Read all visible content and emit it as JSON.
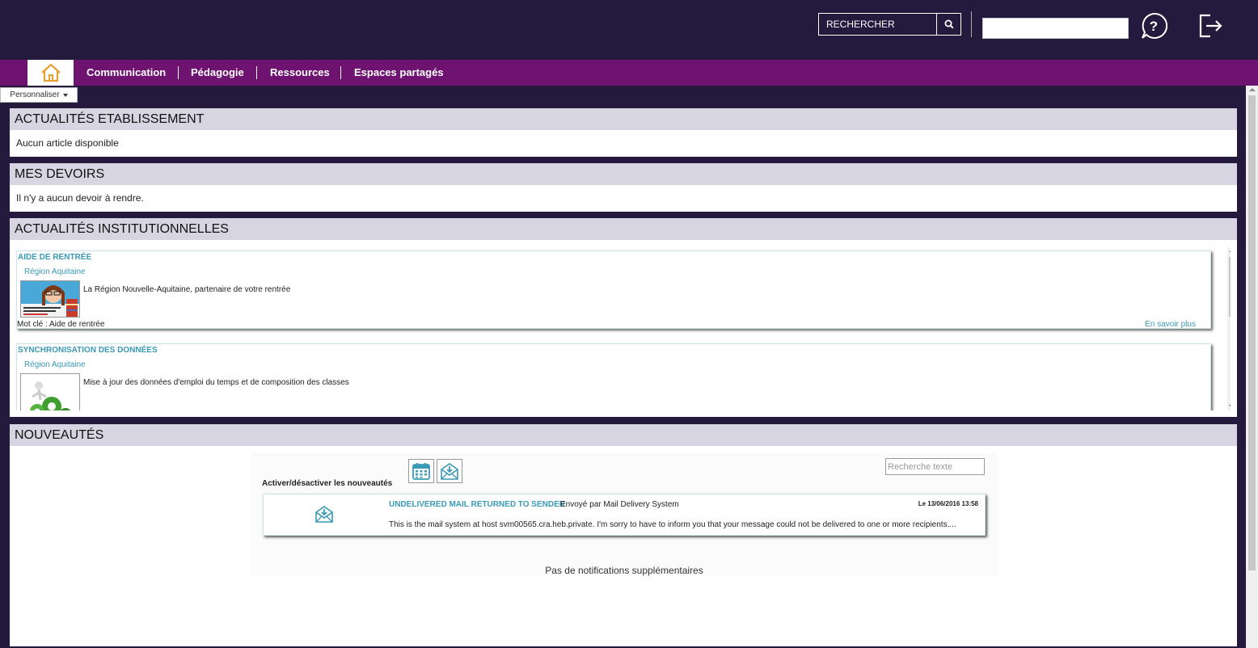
{
  "header": {
    "search_placeholder": "RECHERCHER",
    "user_field_value": "",
    "icons": {
      "search": "search-icon",
      "help": "help-circle-icon",
      "logout": "logout-icon"
    }
  },
  "nav": {
    "home_icon": "home-icon",
    "items": [
      {
        "label": "Communication"
      },
      {
        "label": "Pédagogie"
      },
      {
        "label": "Ressources"
      },
      {
        "label": "Espaces partagés"
      }
    ]
  },
  "personnaliser": {
    "label": "Personnaliser"
  },
  "actualites_etab": {
    "title": "ACTUALITÉS ETABLISSEMENT",
    "empty_text": "Aucun article disponible"
  },
  "devoirs": {
    "title": "MES DEVOIRS",
    "empty_text": "Il n'y a aucun devoir à rendre."
  },
  "actualites_inst": {
    "title": "ACTUALITÉS INSTITUTIONNELLES",
    "items": [
      {
        "title": "AIDE DE RENTRÉE",
        "source": "Région Aquitaine",
        "text": "La Région Nouvelle-Aquitaine, partenaire de votre rentrée",
        "keyword": "Mot clé : Aide de rentrée",
        "more": "En savoir plus"
      },
      {
        "title": "SYNCHRONISATION DES DONNÉES",
        "source": "Région Aquitaine",
        "text": "Mise à jour des données d'emploi du temps et de composition des classes"
      }
    ]
  },
  "nouveautes": {
    "title": "NOUVEAUTÉS",
    "toggle_label": "Activer/désactiver les nouveautés",
    "search_placeholder": "Recherche texte",
    "notification": {
      "title": "UNDELIVERED MAIL RETURNED TO SENDER",
      "sender": "Envoyé par Mail Delivery System",
      "date": "Le 13/06/2016 13:58",
      "message": "This is the mail system at host svm00565.cra.heb.private. I'm sorry to have to inform you that your message could not be delivered to one or more recipients...."
    },
    "no_more": "Pas de notifications supplémentaires"
  },
  "colors": {
    "top_bg": "#241a3d",
    "nav_bg": "#6e1470",
    "panel_head_bg": "#d8d5e2",
    "link_blue": "#3a9ab5",
    "home_orange": "#e6a133"
  }
}
